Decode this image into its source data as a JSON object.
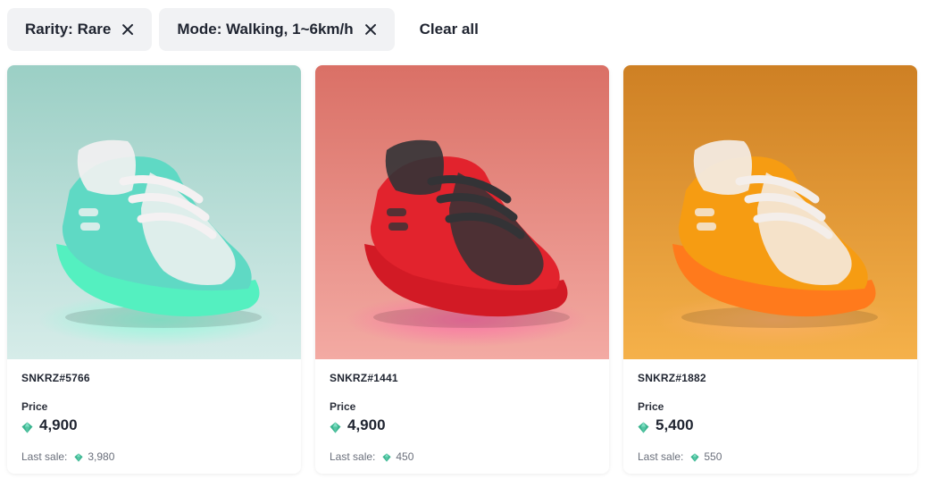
{
  "filters": {
    "chips": [
      {
        "label": "Rarity: Rare"
      },
      {
        "label": "Mode: Walking, 1~6km/h"
      }
    ],
    "clear_label": "Clear all"
  },
  "cards": [
    {
      "name": "SNKRZ#5766",
      "price_label": "Price",
      "price": "4,900",
      "last_sale_label": "Last sale:",
      "last_sale": "3,980",
      "colors": {
        "bg_top": "#9bcfc5",
        "bg_bottom": "#d6ece9",
        "body": "#5fd9c4",
        "accent": "#f4f1f2",
        "sole": "#54f0c0",
        "glow": "#7dffd8"
      }
    },
    {
      "name": "SNKRZ#1441",
      "price_label": "Price",
      "price": "4,900",
      "last_sale_label": "Last sale:",
      "last_sale": "450",
      "colors": {
        "bg_top": "#da7066",
        "bg_bottom": "#f3aaa3",
        "body": "#e2232d",
        "accent": "#333336",
        "sole": "#d21a25",
        "glow": "#ff5fa8"
      }
    },
    {
      "name": "SNKRZ#1882",
      "price_label": "Price",
      "price": "5,400",
      "last_sale_label": "Last sale:",
      "last_sale": "550",
      "colors": {
        "bg_top": "#ce8024",
        "bg_bottom": "#f5b14a",
        "body": "#f69c12",
        "accent": "#f4eeea",
        "sole": "#ff7a1c",
        "glow": "#ffb070"
      }
    }
  ],
  "gem_color": "#3bb48f"
}
